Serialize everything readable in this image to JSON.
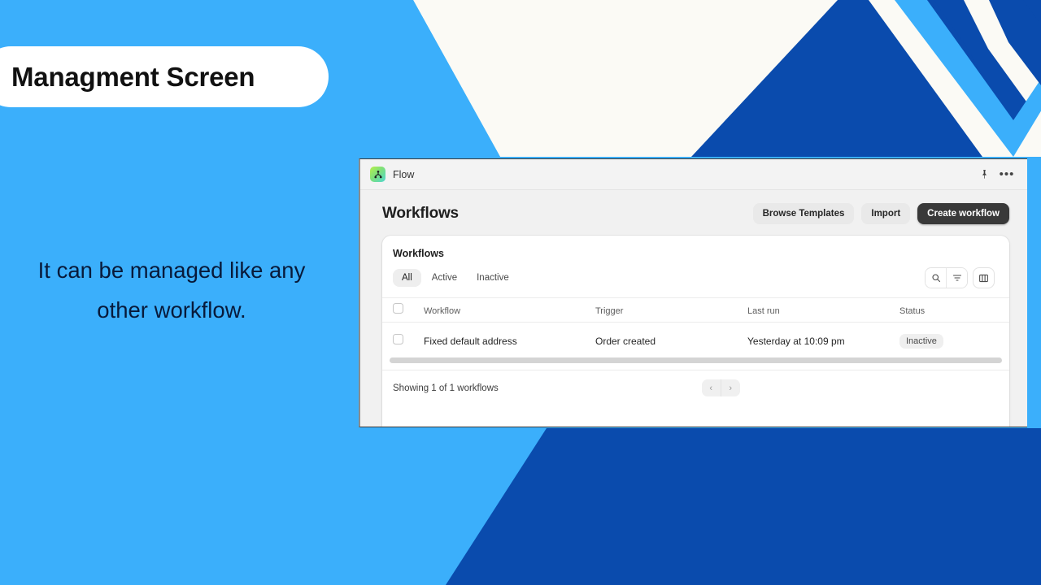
{
  "slide": {
    "title": "Managment Screen",
    "caption": "It can be managed like any other workflow."
  },
  "colors": {
    "light_blue": "#3BAFFB",
    "dark_blue": "#0A4BAD",
    "off_white": "#FBFAF5",
    "title_text": "#111111",
    "caption_text": "#081A3A",
    "accent_dark_button": "#393939"
  },
  "app": {
    "titlebar": {
      "app_name": "Flow",
      "app_icon": "flow-node-icon",
      "pin_icon": "pin-icon",
      "more_icon": "ellipsis-icon"
    },
    "header": {
      "title": "Workflows",
      "buttons": [
        {
          "label": "Browse Templates",
          "style": "secondary"
        },
        {
          "label": "Import",
          "style": "secondary"
        },
        {
          "label": "Create workflow",
          "style": "primary"
        }
      ]
    },
    "card": {
      "title": "Workflows",
      "tabs": [
        {
          "label": "All",
          "active": true
        },
        {
          "label": "Active",
          "active": false
        },
        {
          "label": "Inactive",
          "active": false
        }
      ],
      "tools": [
        {
          "name": "search-icon"
        },
        {
          "name": "filter-icon"
        },
        {
          "name": "columns-icon"
        }
      ],
      "table": {
        "select_all_checkbox": false,
        "columns": [
          "Workflow",
          "Trigger",
          "Last run",
          "Status"
        ],
        "rows": [
          {
            "selected": false,
            "workflow": "Fixed default address",
            "trigger": "Order created",
            "last_run": "Yesterday at 10:09 pm",
            "status": "Inactive"
          }
        ]
      },
      "footer": {
        "showing_text": "Showing 1 of 1 workflows",
        "prev_label": "‹",
        "next_label": "›"
      }
    }
  }
}
